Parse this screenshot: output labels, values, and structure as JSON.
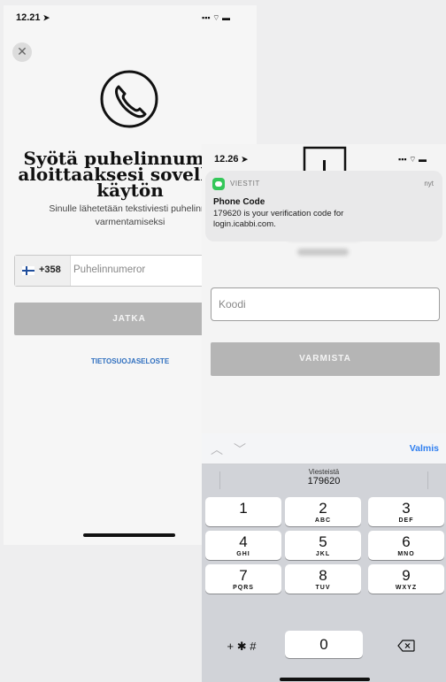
{
  "left": {
    "status_time": "12.21",
    "title_lines": [
      "Syötä puhelinnumero",
      "aloittaaksesi sovelluks",
      "käytön"
    ],
    "subtitle_lines": [
      "Sinulle lähetetään tekstiviesti puhelinnu",
      "varmentamiseksi"
    ],
    "country_code": "+358",
    "phone_placeholder": "Puhelinnumeror",
    "continue_label": "JATKA",
    "privacy_link": "TIETOSUOJASELOSTE"
  },
  "right": {
    "status_time": "12.26",
    "notification": {
      "app": "VIESTIT",
      "time": "nyt",
      "title": "Phone Code",
      "body_line1": "179620 is your verification code for",
      "body_line2": "login.icabbi.com."
    },
    "code_placeholder": "Koodi",
    "verify_label": "VARMISTA",
    "keyboard": {
      "done_label": "Valmis",
      "suggestion_source": "Viesteistä",
      "suggestion_code": "179620",
      "keys": [
        {
          "n": "1",
          "l": ""
        },
        {
          "n": "2",
          "l": "ABC"
        },
        {
          "n": "3",
          "l": "DEF"
        },
        {
          "n": "4",
          "l": "GHI"
        },
        {
          "n": "5",
          "l": "JKL"
        },
        {
          "n": "6",
          "l": "MNO"
        },
        {
          "n": "7",
          "l": "PQRS"
        },
        {
          "n": "8",
          "l": "TUV"
        },
        {
          "n": "9",
          "l": "WXYZ"
        }
      ],
      "symbols_label": "+ ✱ #",
      "zero_label": "0"
    }
  },
  "colors": {
    "link_blue": "#2f6fbf",
    "button_grey": "#b5b5b5",
    "messages_green": "#34c759"
  }
}
